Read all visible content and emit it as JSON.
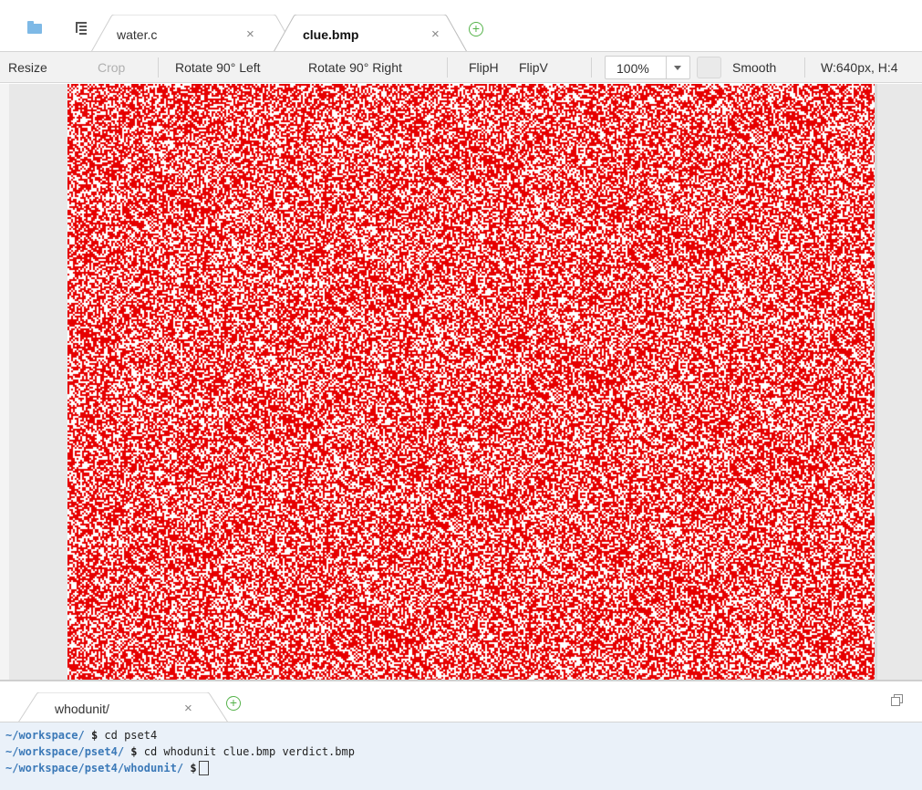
{
  "editor_tabs": {
    "tabs": [
      {
        "label": "water.c",
        "close": "×",
        "active": false
      },
      {
        "label": "clue.bmp",
        "close": "×",
        "active": true
      }
    ],
    "add_icon": "plus-circle-icon",
    "left_icons": [
      "folder-icon",
      "outline-icon"
    ]
  },
  "toolbar": {
    "resize": "Resize",
    "crop": "Crop",
    "rotate_left": "Rotate 90° Left",
    "rotate_right": "Rotate 90° Right",
    "fliph": "FlipH",
    "flipv": "FlipV",
    "zoom_value": "100%",
    "smooth_label": "Smooth",
    "dimensions": "W:640px, H:4"
  },
  "image": {
    "noise_color": "#e60000",
    "speckle_color": "#ffffff"
  },
  "terminal_tabs": {
    "tabs": [
      {
        "label": "whodunit/",
        "close": "×"
      }
    ],
    "add_icon": "plus-circle-icon",
    "restore_icon": "restore-window-icon"
  },
  "terminal": {
    "lines": [
      {
        "prompt": "~/workspace/",
        "dollar": "$",
        "command": "cd pset4"
      },
      {
        "prompt": "~/workspace/pset4/",
        "dollar": "$",
        "command": "cd whodunit clue.bmp verdict.bmp"
      },
      {
        "prompt": "~/workspace/pset4/whodunit/",
        "dollar": "$",
        "command": ""
      }
    ]
  },
  "colors": {
    "accent_green": "#55b34a",
    "prompt_blue": "#3b79b8",
    "terminal_bg": "#eaf1f9",
    "toolbar_bg": "#f2f2f2"
  }
}
